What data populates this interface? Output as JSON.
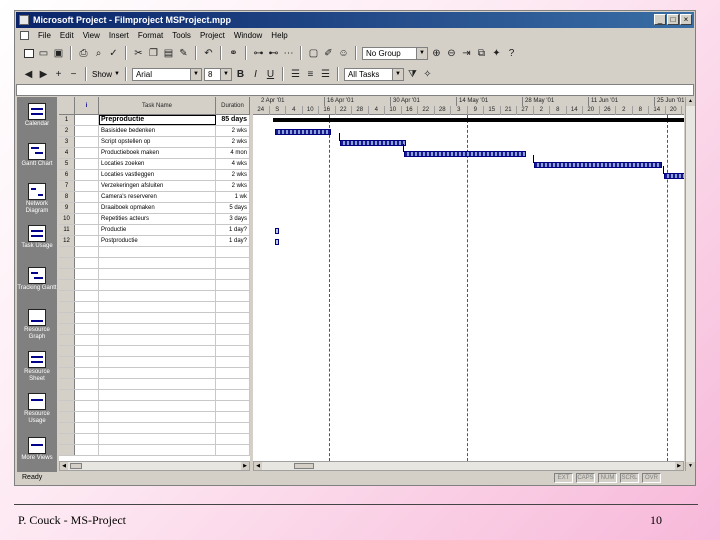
{
  "window": {
    "title": "Microsoft Project - Filmproject MSProject.mpp"
  },
  "window_buttons": [
    "_",
    "□",
    "×"
  ],
  "menu": [
    "File",
    "Edit",
    "View",
    "Insert",
    "Format",
    "Tools",
    "Project",
    "Window",
    "Help"
  ],
  "toolbar1": {
    "group_combo": "No Group"
  },
  "toolbar2": {
    "show_label": "Show",
    "font_combo": "Arial",
    "size_combo": "8",
    "bold": "B",
    "italic": "I",
    "underline": "U",
    "filter_combo": "All Tasks"
  },
  "views": [
    {
      "label": "Calendar"
    },
    {
      "label": "Gantt Chart"
    },
    {
      "label": "Network Diagram"
    },
    {
      "label": "Task Usage"
    },
    {
      "label": "Tracking Gantt"
    },
    {
      "label": "Resource Graph"
    },
    {
      "label": "Resource Sheet"
    },
    {
      "label": "Resource Usage"
    },
    {
      "label": "More Views"
    }
  ],
  "sheet": {
    "headers": {
      "indicator": "i",
      "name": "Task Name",
      "duration": "Duration"
    },
    "rows": [
      {
        "id": "1",
        "name": "Preproductie",
        "duration": "85 days",
        "summary": true
      },
      {
        "id": "2",
        "name": "Basisidee bedenken",
        "duration": "2 wks"
      },
      {
        "id": "3",
        "name": "Script opstellen op",
        "duration": "2 wks"
      },
      {
        "id": "4",
        "name": "Productieboek maken",
        "duration": "4 mon"
      },
      {
        "id": "5",
        "name": "Locaties zoeken",
        "duration": "4 wks"
      },
      {
        "id": "6",
        "name": "Locaties vastleggen",
        "duration": "2 wks"
      },
      {
        "id": "7",
        "name": "Verzekeringen afsluiten",
        "duration": "2 wks"
      },
      {
        "id": "8",
        "name": "Camera's reserveren",
        "duration": "1 wk"
      },
      {
        "id": "9",
        "name": "Draaiboek opmaken",
        "duration": "5 days"
      },
      {
        "id": "10",
        "name": "Repetities acteurs",
        "duration": "3 days"
      },
      {
        "id": "11",
        "name": "Productie",
        "duration": "1 day?"
      },
      {
        "id": "12",
        "name": "Postproductie",
        "duration": "1 day?"
      }
    ]
  },
  "timescale": {
    "major": [
      "2 Apr '01",
      "16 Apr '01",
      "30 Apr '01",
      "14 May '01",
      "28 May '01",
      "11 Jun '01",
      "25 Jun '01"
    ],
    "minor": [
      "24",
      "S",
      "4",
      "10",
      "16",
      "22",
      "28",
      "4",
      "10",
      "16",
      "22",
      "28",
      "3",
      "9",
      "15",
      "21",
      "27",
      "2",
      "8",
      "14",
      "20",
      "26",
      "2",
      "8",
      "14",
      "20"
    ]
  },
  "status": {
    "text": "Ready",
    "indicators": [
      "EXT",
      "CAPS",
      "NUM",
      "SCRL",
      "OVR"
    ]
  },
  "footer": {
    "left": "P. Couck - MS-Project",
    "right": "10"
  }
}
